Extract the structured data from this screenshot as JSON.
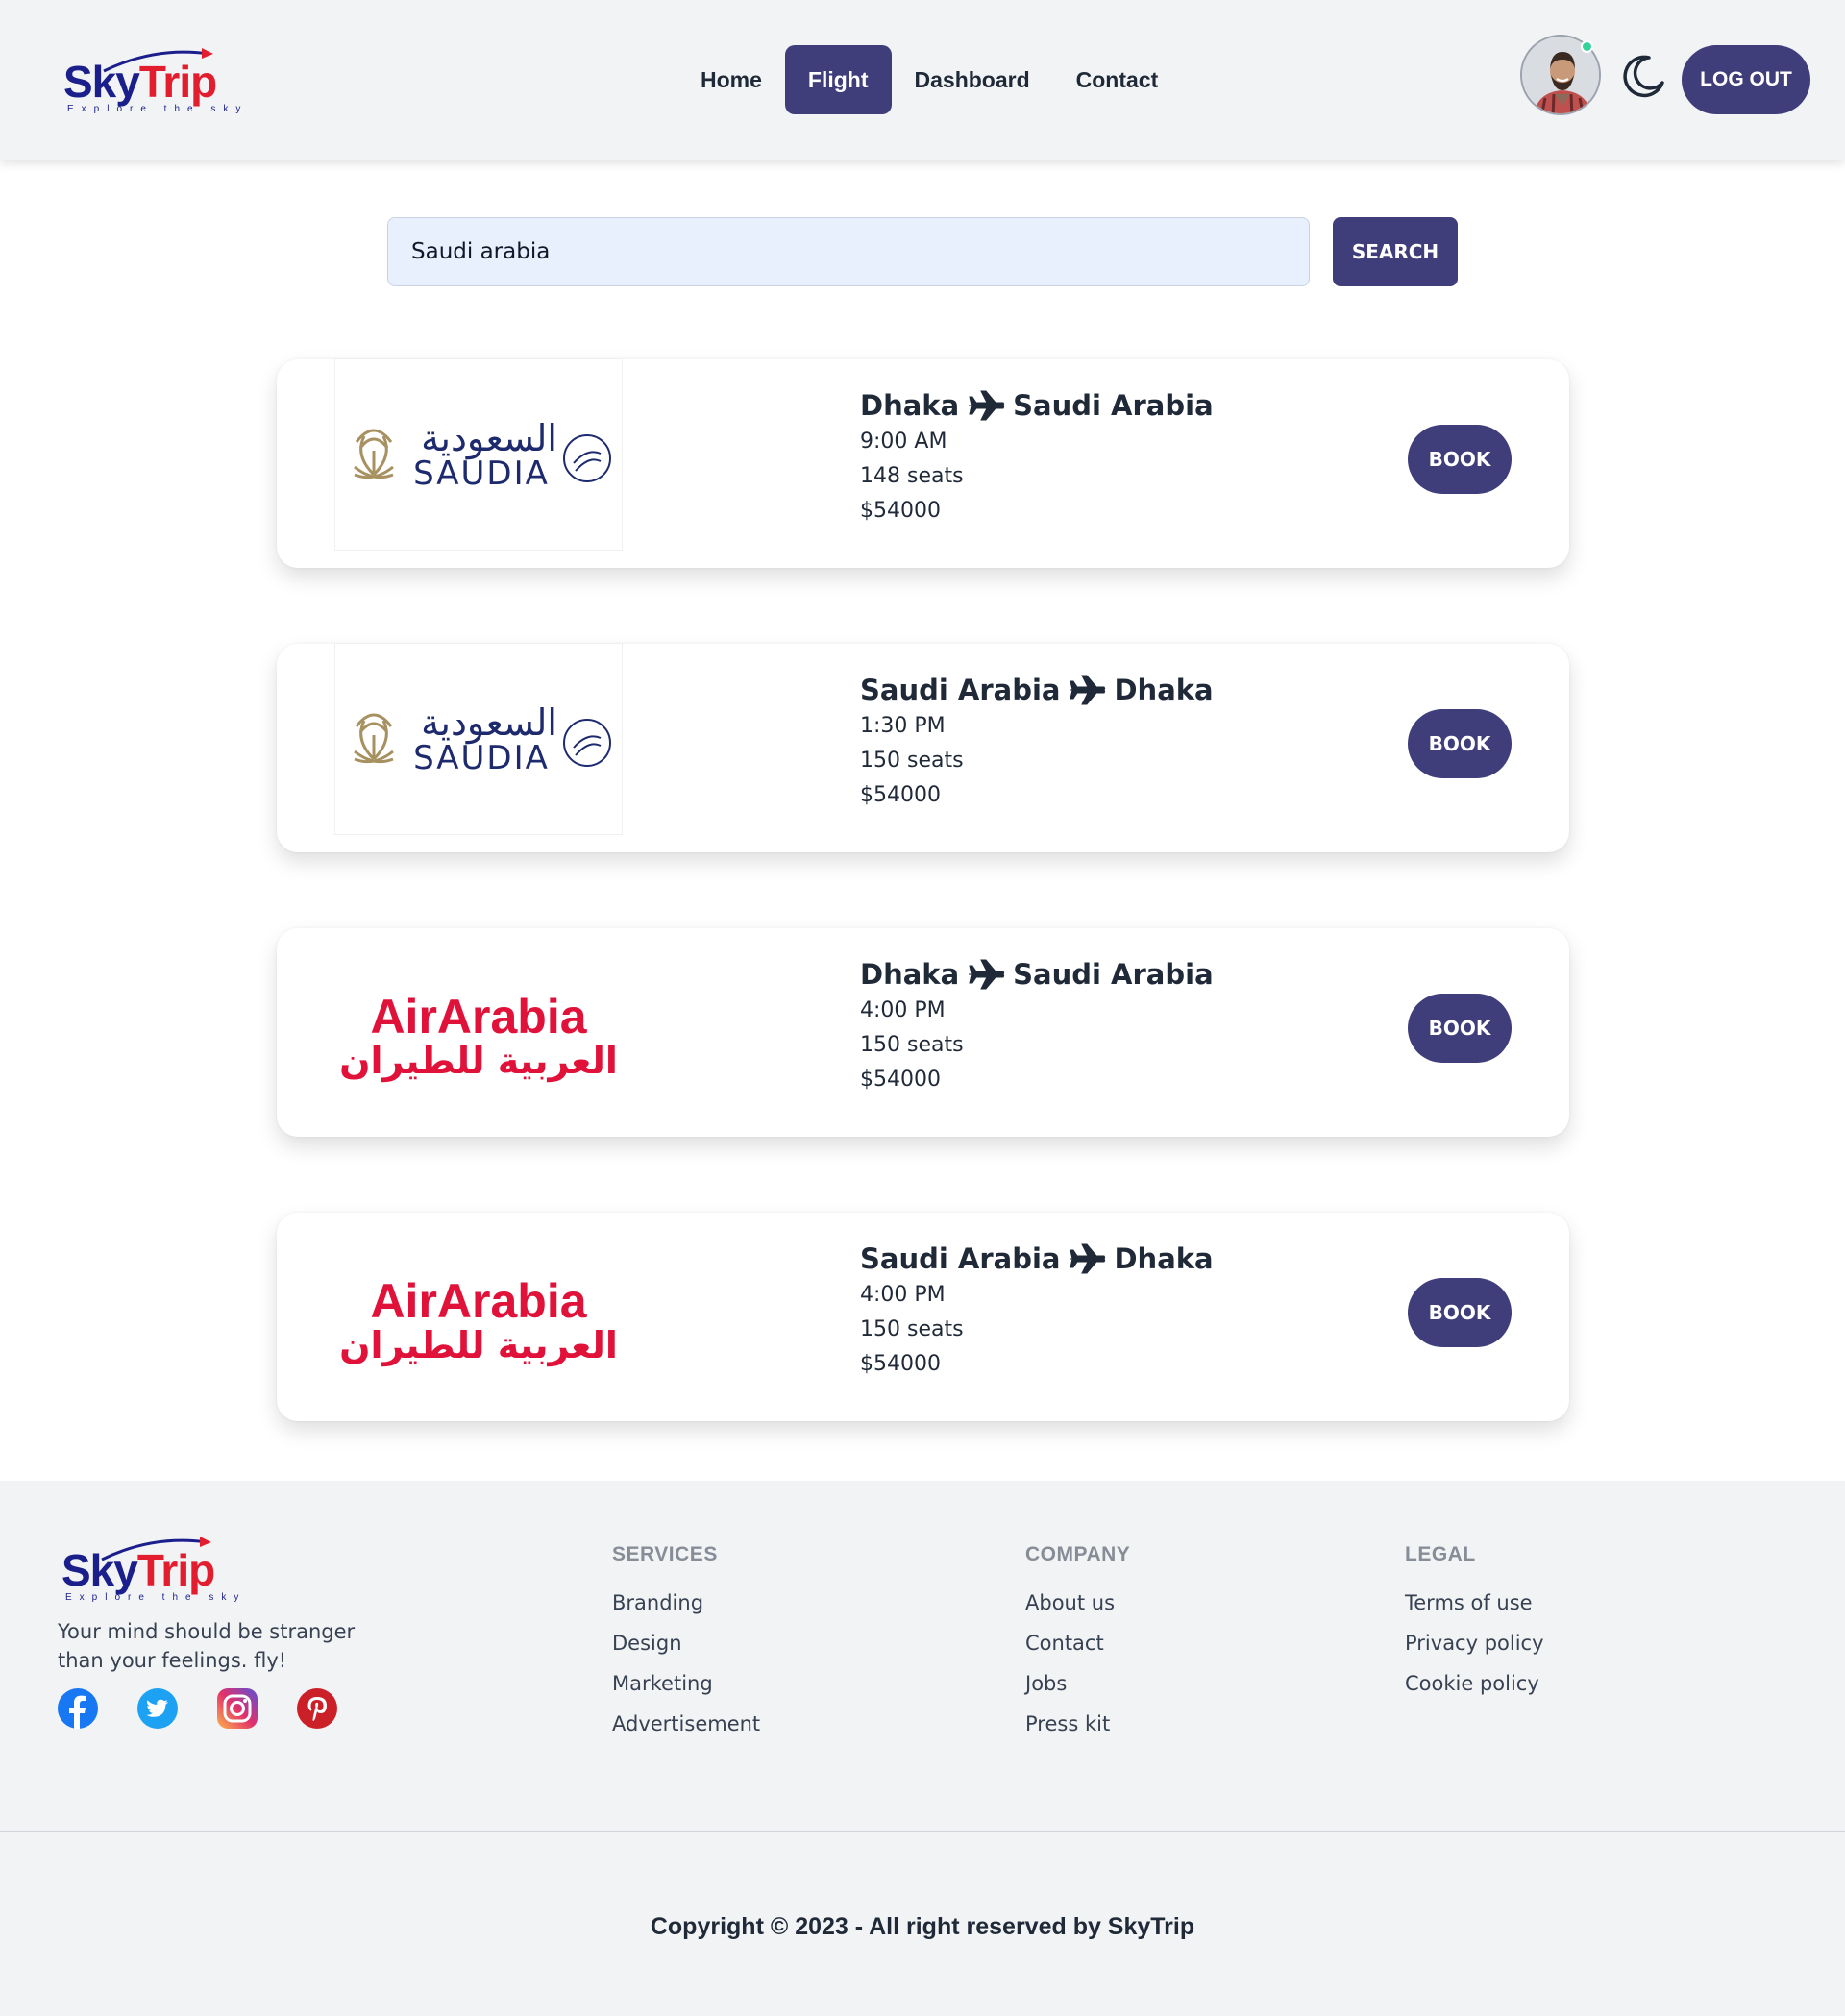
{
  "brand": {
    "name_part1": "Sky",
    "name_part2": "Trip",
    "tagline": "Explore the sky"
  },
  "nav": {
    "links": [
      {
        "label": "Home",
        "active": false
      },
      {
        "label": "Flight",
        "active": true
      },
      {
        "label": "Dashboard",
        "active": false
      },
      {
        "label": "Contact",
        "active": false
      }
    ],
    "avatar_icon": "user-avatar",
    "online_status": "online",
    "theme_toggle_icon": "moon-icon",
    "logout_label": "LOG OUT"
  },
  "search": {
    "value": "Saudi arabia",
    "button_label": "SEARCH"
  },
  "flights": [
    {
      "airline": "SAUDIA",
      "airline_arabic": "السعودية",
      "from": "Dhaka",
      "to": "Saudi Arabia",
      "time": "9:00 AM",
      "seats": "148 seats",
      "price": "$54000",
      "book_label": "BOOK"
    },
    {
      "airline": "SAUDIA",
      "airline_arabic": "السعودية",
      "from": "Saudi Arabia",
      "to": "Dhaka",
      "time": "1:30 PM",
      "seats": "150 seats",
      "price": "$54000",
      "book_label": "BOOK"
    },
    {
      "airline": "AirArabia",
      "airline_arabic": "العربية للطيران",
      "from": "Dhaka",
      "to": "Saudi Arabia",
      "time": "4:00 PM",
      "seats": "150 seats",
      "price": "$54000",
      "book_label": "BOOK"
    },
    {
      "airline": "AirArabia",
      "airline_arabic": "العربية للطيران",
      "from": "Saudi Arabia",
      "to": "Dhaka",
      "time": "4:00 PM",
      "seats": "150 seats",
      "price": "$54000",
      "book_label": "BOOK"
    }
  ],
  "footer": {
    "tagline": "Your mind should be stranger than your feelings. fly!",
    "socials": [
      "facebook-icon",
      "twitter-icon",
      "instagram-icon",
      "pinterest-icon"
    ],
    "columns": [
      {
        "title": "SERVICES",
        "links": [
          "Branding",
          "Design",
          "Marketing",
          "Advertisement"
        ]
      },
      {
        "title": "COMPANY",
        "links": [
          "About us",
          "Contact",
          "Jobs",
          "Press kit"
        ]
      },
      {
        "title": "LEGAL",
        "links": [
          "Terms of use",
          "Privacy policy",
          "Cookie policy"
        ]
      }
    ],
    "copyright": "Copyright © 2023 - All right reserved by SkyTrip"
  },
  "colors": {
    "primary": "#3f3d7a",
    "brand_blue": "#1b1f8c",
    "brand_red": "#e11d2e",
    "saudia_blue": "#1d2a6e",
    "saudia_gold": "#a89161",
    "airarabia_red": "#e0123a",
    "online": "#34d399"
  }
}
